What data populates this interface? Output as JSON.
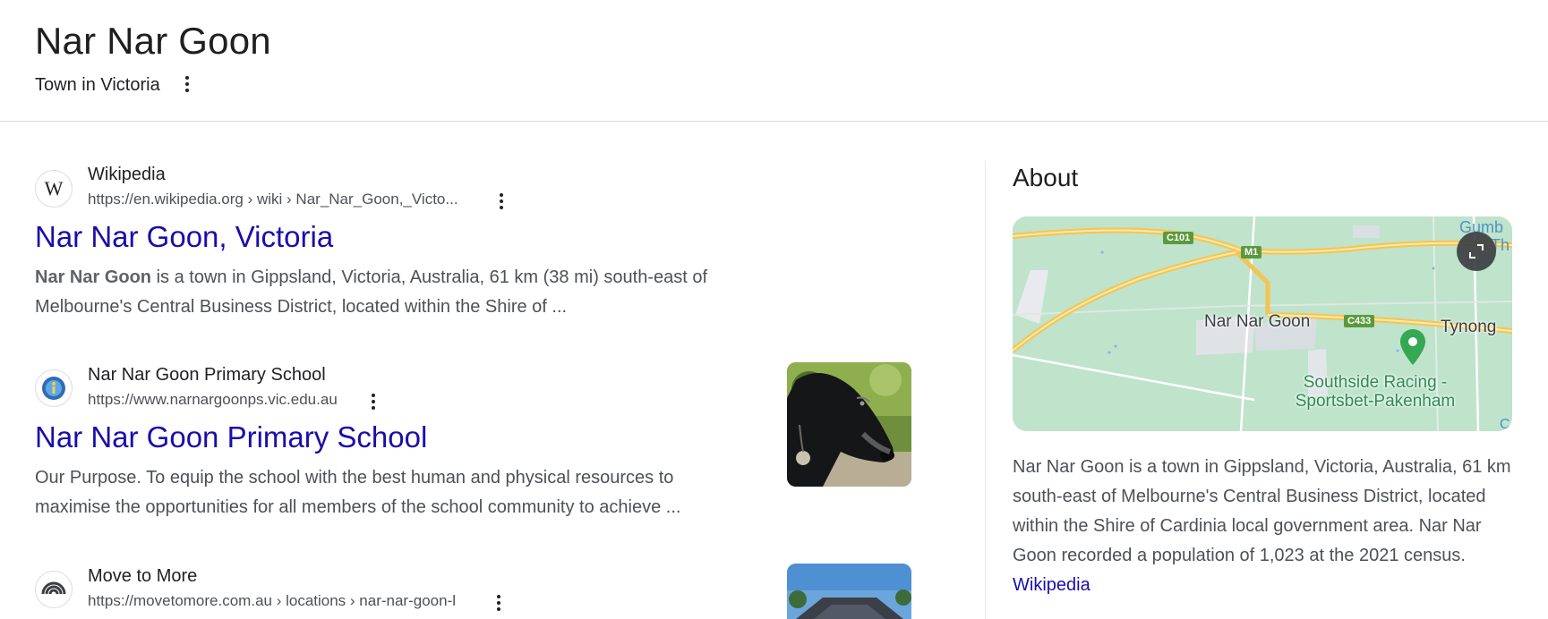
{
  "header": {
    "title": "Nar Nar Goon",
    "subtitle": "Town in Victoria"
  },
  "results": [
    {
      "site_name": "Wikipedia",
      "url": "https://en.wikipedia.org › wiki › Nar_Nar_Goon,_Victo...",
      "title": "Nar Nar Goon, Victoria",
      "snippet_bold": "Nar Nar Goon",
      "snippet_rest": " is a town in Gippsland, Victoria, Australia, 61 km (38 mi) south-east of Melbourne's Central Business District, located within the Shire of ...",
      "favicon": "wikipedia-logo-icon"
    },
    {
      "site_name": "Nar Nar Goon Primary School",
      "url": "https://www.narnargoonps.vic.edu.au",
      "title": "Nar Nar Goon Primary School",
      "snippet": "Our Purpose. To equip the school with the best human and physical resources to maximise the opportunities for all members of the school community to achieve ...",
      "favicon": "school-badge-icon",
      "thumbnail": "greyhound-photo"
    },
    {
      "site_name": "Move to More",
      "url": "https://movetomore.com.au › locations › nar-nar-goon-l",
      "favicon": "move-to-more-logo-icon",
      "thumbnail": "building-photo"
    }
  ],
  "about": {
    "heading": "About",
    "map": {
      "place_label": "Nar Nar Goon",
      "nearby_label": "Tynong",
      "poi_label_line1": "Southside Racing -",
      "poi_label_line2": "Sportsbet-Pakenham",
      "road_c101": "C101",
      "road_m1": "M1",
      "road_c433": "C433",
      "edge_label_1": "Gumb",
      "edge_label_2": "Th",
      "edge_label_3": "C",
      "expand_icon": "expand-icon"
    },
    "description": "Nar Nar Goon is a town in Gippsland, Victoria, Australia, 61 km south-east of Melbourne's Central Business District, located within the Shire of Cardinia local government area. Nar Nar Goon recorded a population of 1,023 at the 2021 census. ",
    "source_link": "Wikipedia"
  },
  "colors": {
    "link": "#1a0dab",
    "snippet": "#4d5156",
    "map_land": "#bfe3cb",
    "map_road": "#f5c453",
    "road_shield": "#5b9a3c",
    "poi_pin": "#34a853"
  }
}
